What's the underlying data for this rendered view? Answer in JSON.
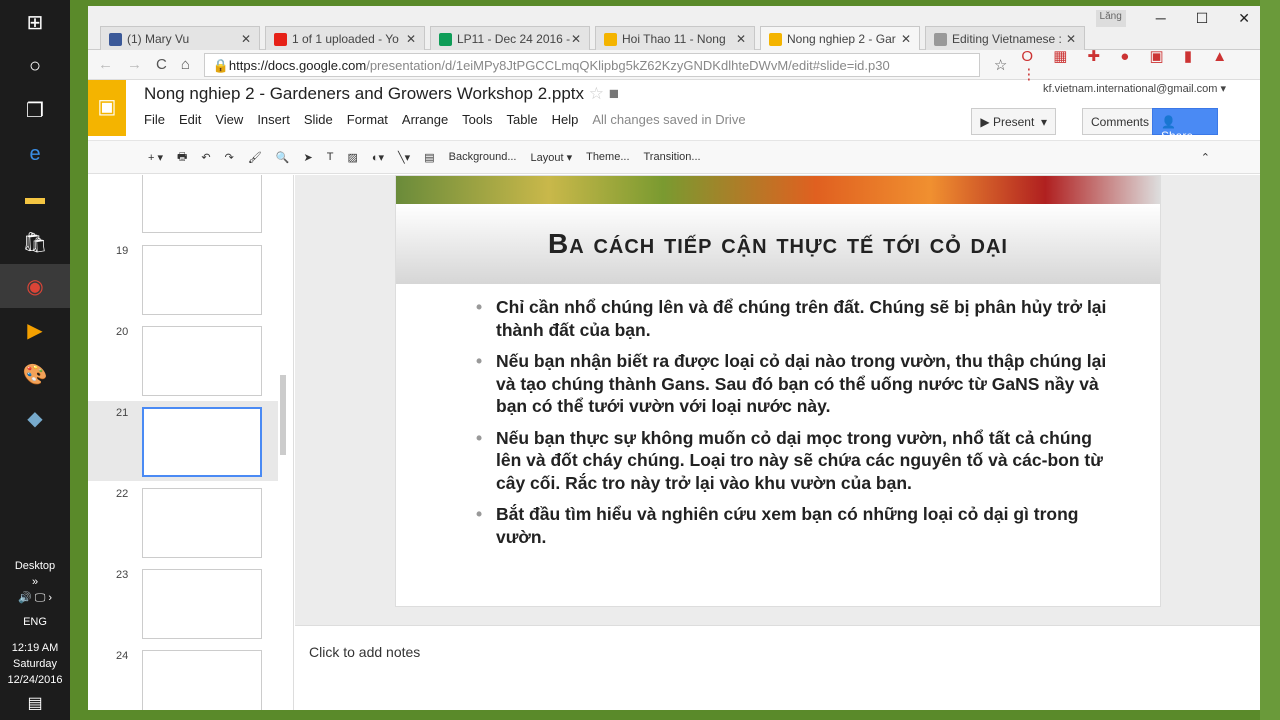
{
  "taskbar": {
    "desktop": "Desktop",
    "lang": "ENG",
    "time": "12:19 AM",
    "day": "Saturday",
    "date": "12/24/2016"
  },
  "browser": {
    "tabs": [
      {
        "label": "(1) Mary Vu",
        "color": "#3b5998"
      },
      {
        "label": "1 of 1 uploaded - Yo",
        "color": "#e62117"
      },
      {
        "label": "LP11 - Dec 24 2016 -",
        "color": "#0f9d58"
      },
      {
        "label": "Hoi Thao 11 - Nong",
        "color": "#f4b400"
      },
      {
        "label": "Nong nghiep 2 - Gar",
        "color": "#f4b400"
      },
      {
        "label": "Editing Vietnamese :",
        "color": "#999999"
      }
    ],
    "user_badge": "Lăng",
    "url_host": "https://docs.google.com",
    "url_path": "/presentation/d/1eiMPy8JtPGCCLmqQKlipbg5kZ62KzyGNDKdlhteDWvM/edit#slide=id.p30"
  },
  "app": {
    "title": "Nong nghiep 2 - Gardeners and Growers Workshop 2.pptx",
    "account": "kf.vietnam.international@gmail.com",
    "menu": [
      "File",
      "Edit",
      "View",
      "Insert",
      "Slide",
      "Format",
      "Arrange",
      "Tools",
      "Table",
      "Help"
    ],
    "saved": "All changes saved in Drive",
    "present": "Present",
    "comments": "Comments",
    "share": "Share",
    "toolbar": {
      "background": "Background...",
      "layout": "Layout",
      "theme": "Theme...",
      "transition": "Transition..."
    }
  },
  "filmstrip": [
    {
      "num": "19"
    },
    {
      "num": "20"
    },
    {
      "num": "21",
      "selected": true
    },
    {
      "num": "22"
    },
    {
      "num": "23"
    },
    {
      "num": "24"
    }
  ],
  "slide": {
    "title": "Ba cách tiếp cận thực tế tới cỏ dại",
    "bullets": [
      "Chỉ cần nhổ chúng lên và để chúng trên đất. Chúng sẽ bị phân hủy trở lại thành đất của bạn.",
      "Nếu bạn nhận biết ra được loại cỏ dại nào trong vườn, thu thập chúng lại và tạo chúng thành Gans. Sau đó bạn có thể uống nước từ GaNS nầy và bạn có thể tưới vườn với loại nước này.",
      "Nếu bạn thực sự không muốn cỏ dại mọc trong vườn, nhổ tất cả chúng lên và đốt cháy chúng. Loại tro này sẽ chứa các nguyên tố và các-bon từ cây cối. Rắc tro này trở lại vào khu vườn của bạn.",
      "Bắt đầu tìm hiểu và nghiên cứu xem bạn có những loại cỏ dại gì trong vườn."
    ]
  },
  "notes": "Click to add notes"
}
